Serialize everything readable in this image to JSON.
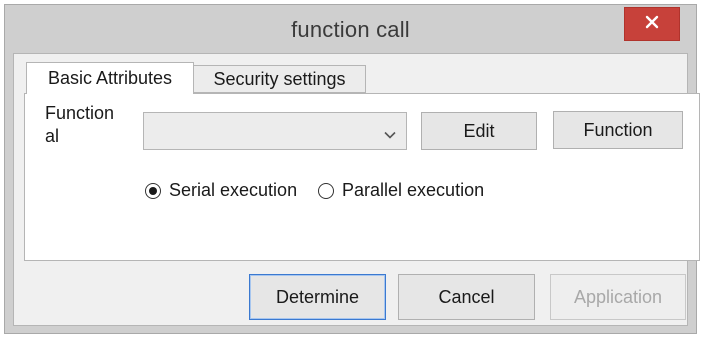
{
  "window": {
    "title": "function call",
    "close_icon": "close-icon",
    "close_color": "#c7413a"
  },
  "tabs": [
    {
      "label": "Basic Attributes",
      "selected": true
    },
    {
      "label": "Security settings",
      "selected": false
    }
  ],
  "basic": {
    "function_label": "Function\nal",
    "function_value": "",
    "edit_label": "Edit",
    "function_button_label": "Function",
    "execution": {
      "serial_label": "Serial execution",
      "parallel_label": "Parallel execution",
      "selected": "serial"
    }
  },
  "footer": {
    "determine_label": "Determine",
    "cancel_label": "Cancel",
    "application_label": "Application"
  }
}
